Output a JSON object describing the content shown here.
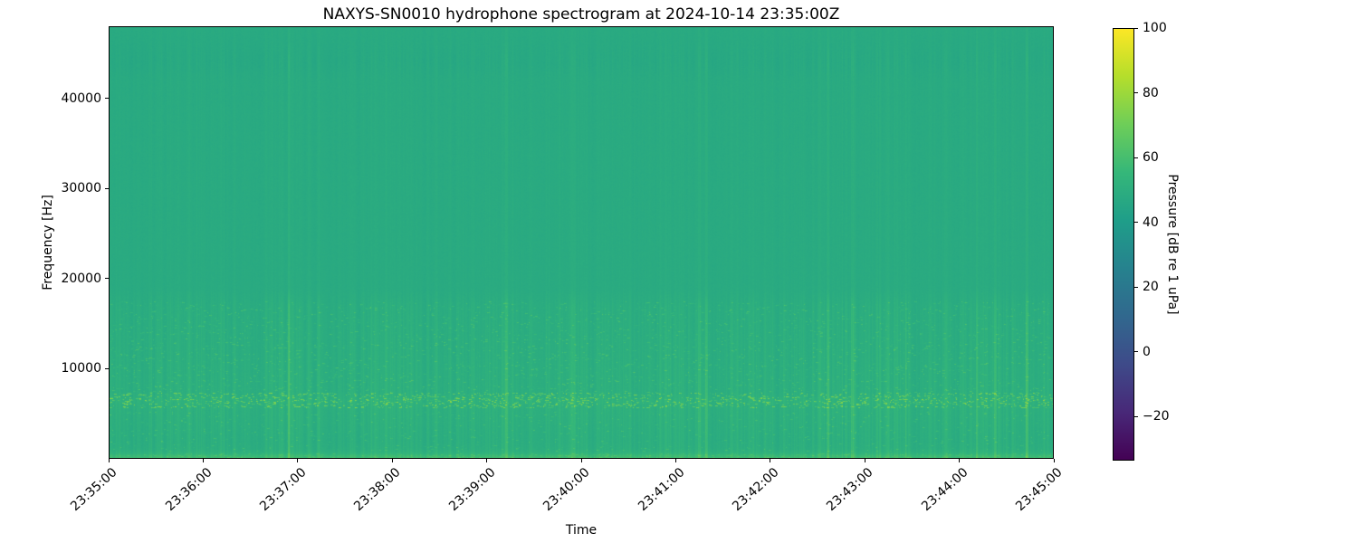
{
  "figure": {
    "background_color": "#ffffff",
    "text_color": "#000000",
    "axis_color": "#000000"
  },
  "chart_data": {
    "type": "heatmap",
    "subtype": "spectrogram",
    "title": "NAXYS-SN0010 hydrophone spectrogram at 2024-10-14 23:35:00Z",
    "xlabel": "Time",
    "ylabel": "Frequency [Hz]",
    "x_tick_labels": [
      "23:35:00",
      "23:36:00",
      "23:37:00",
      "23:38:00",
      "23:39:00",
      "23:40:00",
      "23:41:00",
      "23:42:00",
      "23:43:00",
      "23:44:00",
      "23:45:00"
    ],
    "y_tick_values": [
      10000,
      20000,
      30000,
      40000
    ],
    "y_tick_labels": [
      "10000",
      "20000",
      "30000",
      "40000"
    ],
    "ylim": [
      0,
      48000
    ],
    "grid": false,
    "colorbar": {
      "label": "Pressure [dB re 1 uPa]",
      "tick_values": [
        100,
        80,
        60,
        40,
        20,
        0,
        -20
      ],
      "tick_labels": [
        "100",
        "80",
        "60",
        "40",
        "20",
        "0",
        "−20"
      ],
      "vmin": -33.7,
      "vmax": 100,
      "colormap": "viridis",
      "position": "right",
      "viridis_stops": [
        "#440154",
        "#482878",
        "#3e4a89",
        "#31688e",
        "#26828e",
        "#1f9e89",
        "#35b779",
        "#6ece58",
        "#b5de2b",
        "#fde725"
      ]
    },
    "heatmap_profile": {
      "description": "Mostly uniform teal field near 48 dB; vertical striations strongest below 18 kHz; bright speckled tonal band near 6.5 kHz reaching ~75 dB; bright ~56-58 dB band near 0 Hz; subtle darker textured band near 44 kHz.",
      "base_db": [
        [
          0,
          58
        ],
        [
          400,
          56.5
        ],
        [
          700,
          52
        ],
        [
          1200,
          50
        ],
        [
          2000,
          49.5
        ],
        [
          5500,
          50.5
        ],
        [
          6500,
          51.5
        ],
        [
          7400,
          50
        ],
        [
          12000,
          49.5
        ],
        [
          17000,
          49
        ],
        [
          19000,
          48
        ],
        [
          42000,
          47.8
        ],
        [
          44000,
          46.8
        ],
        [
          46000,
          47.3
        ],
        [
          48000,
          47.8
        ]
      ],
      "striation_db": [
        [
          0,
          2.6
        ],
        [
          800,
          2.4
        ],
        [
          6500,
          2.6
        ],
        [
          17000,
          2.0
        ],
        [
          19000,
          0.7
        ],
        [
          42000,
          0.8
        ],
        [
          44000,
          1.5
        ],
        [
          46500,
          0.6
        ],
        [
          48000,
          0.5
        ]
      ],
      "speckle_bands": [
        {
          "f_lo": 5700,
          "f_hi": 7400,
          "density": 0.09,
          "boost_min": 6,
          "boost_max": 26
        },
        {
          "f_lo": 900,
          "f_hi": 5300,
          "density": 0.015,
          "boost_min": 3,
          "boost_max": 11
        },
        {
          "f_lo": 7400,
          "f_hi": 17500,
          "density": 0.025,
          "boost_min": 3,
          "boost_max": 12
        },
        {
          "f_lo": 80,
          "f_hi": 700,
          "density": 0.06,
          "boost_min": 2,
          "boost_max": 8
        }
      ],
      "noise_db": 0.8,
      "transient_column_probability": 0.025,
      "seed": 42
    }
  }
}
